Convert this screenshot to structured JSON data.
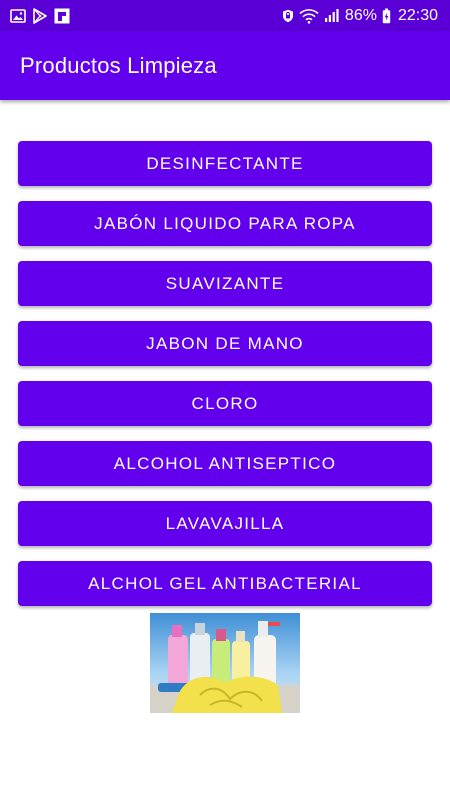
{
  "status_bar": {
    "battery": "86%",
    "time": "22:30",
    "left_icons": [
      "image-icon",
      "play-store-icon",
      "flipboard-icon"
    ],
    "right_icons": [
      "shield-icon",
      "wifi-icon",
      "signal-icon",
      "battery-icon"
    ]
  },
  "app_bar": {
    "title": "Productos Limpieza",
    "color": "#6200ee"
  },
  "buttons": [
    {
      "label": "DESINFECTANTE"
    },
    {
      "label": "JABÓN LIQUIDO PARA ROPA"
    },
    {
      "label": "SUAVIZANTE"
    },
    {
      "label": "JABON DE MANO"
    },
    {
      "label": "CLORO"
    },
    {
      "label": "ALCOHOL ANTISEPTICO"
    },
    {
      "label": "LAVAVAJILLA"
    },
    {
      "label": "ALCHOL GEL ANTIBACTERIAL"
    }
  ],
  "colors": {
    "primary": "#6200ee",
    "status_bar": "#5a00d6",
    "on_primary": "#ffffff"
  }
}
